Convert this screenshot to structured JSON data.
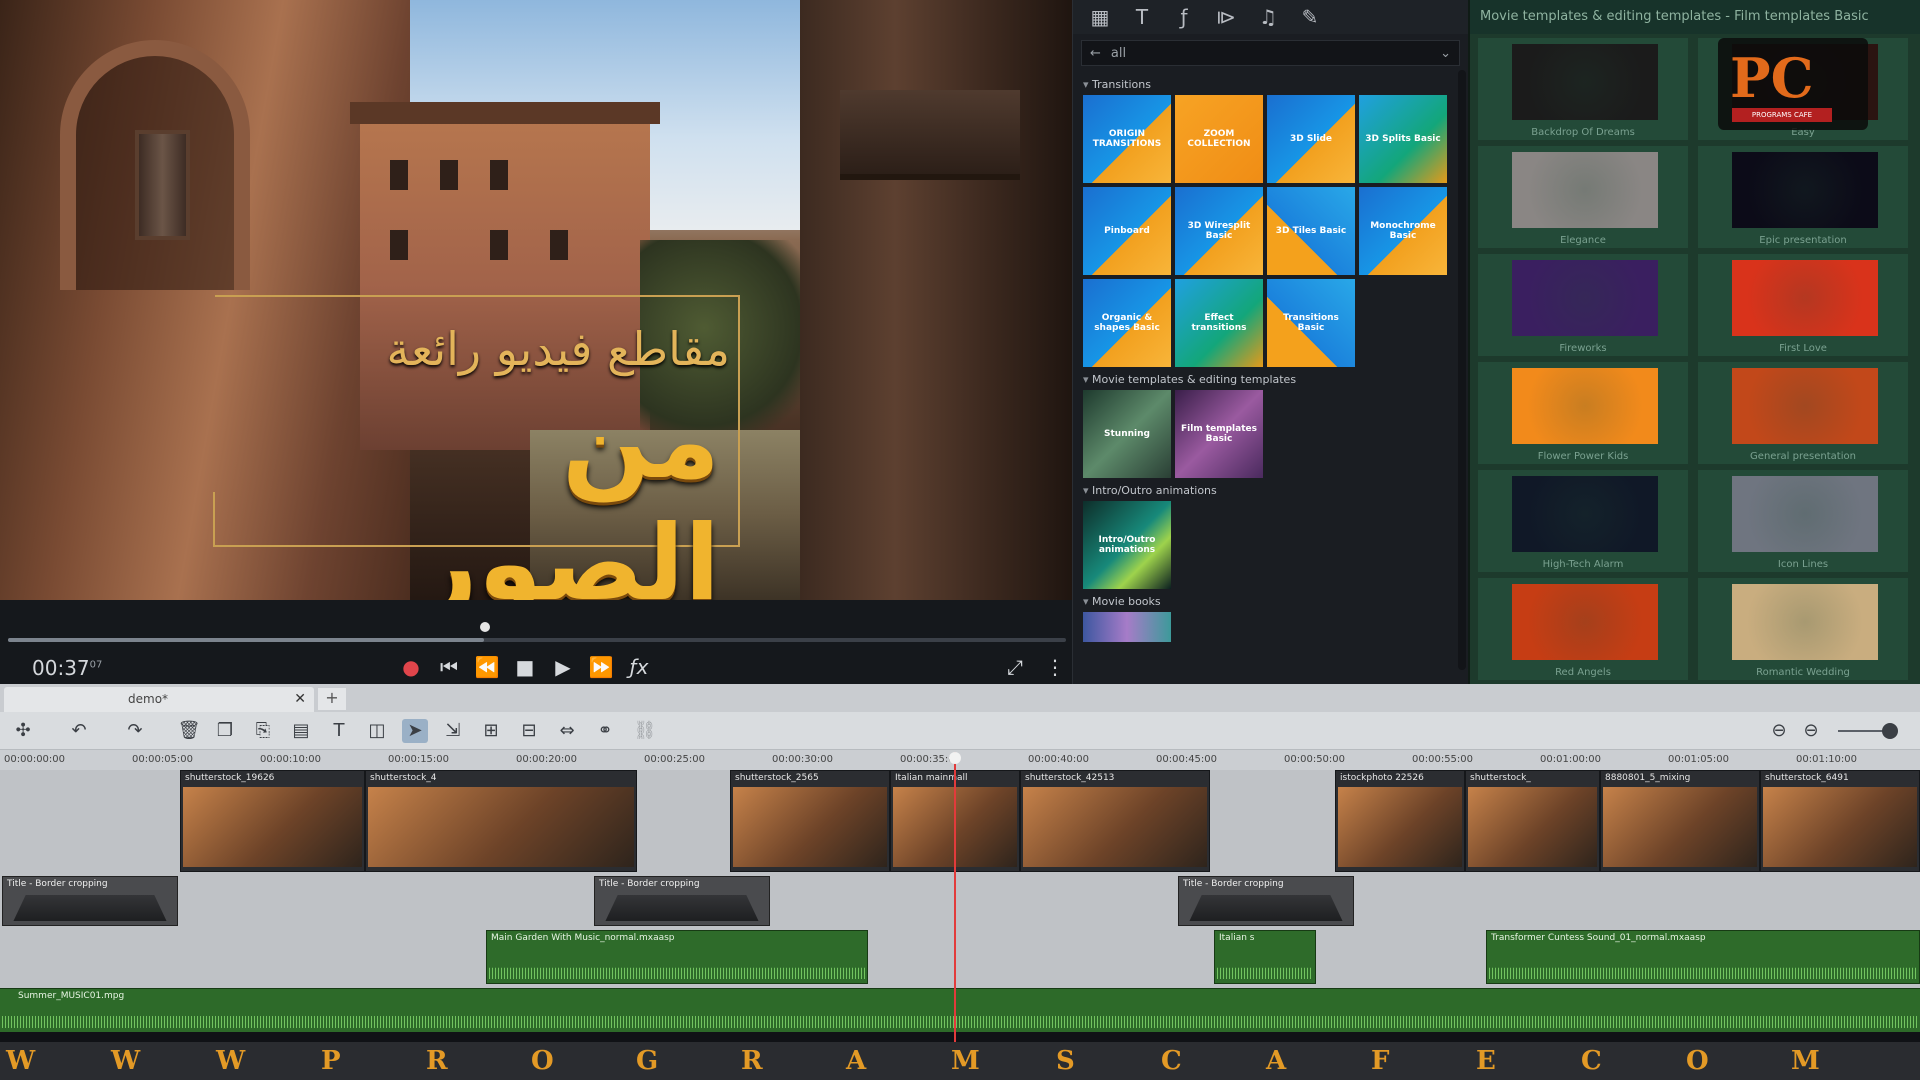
{
  "preview": {
    "title_line1": "مقاطع فيديو رائعة",
    "title_line2": "من الصور",
    "timecode": "00:37",
    "timecode_frames": "07",
    "scrub_fraction": 0.45
  },
  "pool": {
    "filter_label": "all",
    "categories": {
      "transitions": "Transitions",
      "movie": "Movie templates & editing templates",
      "intro": "Intro/Outro animations",
      "moviebooks": "Movie books"
    },
    "transitions": [
      {
        "label": "ORIGIN TRANSITIONS",
        "style": "blue"
      },
      {
        "label": "ZOOM COLLECTION",
        "style": "orange"
      },
      {
        "label": "3D Slide",
        "style": "blue"
      },
      {
        "label": "3D Splits Basic",
        "style": "green"
      },
      {
        "label": "Pinboard",
        "style": "blue"
      },
      {
        "label": "3D Wiresplit Basic",
        "style": "blue"
      },
      {
        "label": "3D Tiles Basic",
        "style": "mix"
      },
      {
        "label": "Monochrome Basic",
        "style": "blue"
      },
      {
        "label": "Organic & shapes Basic",
        "style": "blue"
      },
      {
        "label": "Effect transitions",
        "style": "green"
      },
      {
        "label": "Transitions Basic",
        "style": "mix"
      }
    ],
    "movie_templates": [
      {
        "label": "Stunning",
        "style": "mov1"
      },
      {
        "label": "Film templates Basic",
        "style": "mov2"
      }
    ],
    "intro_templates": [
      {
        "label": "Intro/Outro animations",
        "style": "intro"
      }
    ]
  },
  "templates": {
    "header": "Movie templates & editing templates - Film templates Basic",
    "items": [
      {
        "label": "Backdrop Of Dreams",
        "color": "#1b1b1b"
      },
      {
        "label": "Easy",
        "color": "#2b1411"
      },
      {
        "label": "Elegance",
        "color": "#8a8684"
      },
      {
        "label": "Epic presentation",
        "color": "#0c0b18"
      },
      {
        "label": "Fireworks",
        "color": "#3a1f60"
      },
      {
        "label": "First Love",
        "color": "#d9331b"
      },
      {
        "label": "Flower Power Kids",
        "color": "#f28a1b"
      },
      {
        "label": "General presentation",
        "color": "#c2481a"
      },
      {
        "label": "High-Tech Alarm",
        "color": "#101827"
      },
      {
        "label": "Icon Lines",
        "color": "#6f7580"
      },
      {
        "label": "Red Angels",
        "color": "#c63d14"
      },
      {
        "label": "Romantic Wedding",
        "color": "#c9ad7f"
      }
    ],
    "logo_text": "PC",
    "logo_sub": "PROGRAMS CAFE"
  },
  "timeline": {
    "tab_label": "demo*",
    "ruler": [
      "00:00:00:00",
      "00:00:05:00",
      "00:00:10:00",
      "00:00:15:00",
      "00:00:20:00",
      "00:00:25:00",
      "00:00:30:00",
      "00:00:35:00",
      "00:00:40:00",
      "00:00:45:00",
      "00:00:50:00",
      "00:00:55:00",
      "00:01:00:00",
      "00:01:05:00",
      "00:01:10:00"
    ],
    "video_clips": [
      {
        "label": "shutterstock_19626",
        "start": 180,
        "width": 185
      },
      {
        "label": "shutterstock_4",
        "start": 365,
        "width": 272
      },
      {
        "label": "shutterstock_2565",
        "start": 730,
        "width": 160
      },
      {
        "label": "Italian mainmall",
        "start": 890,
        "width": 130
      },
      {
        "label": "shutterstock_42513",
        "start": 1020,
        "width": 190
      },
      {
        "label": "istockphoto 22526",
        "start": 1335,
        "width": 130
      },
      {
        "label": "shutterstock_",
        "start": 1465,
        "width": 135
      },
      {
        "label": "8880801_5_mixing",
        "start": 1600,
        "width": 160
      },
      {
        "label": "shutterstock_6491",
        "start": 1760,
        "width": 160
      }
    ],
    "title_clips": [
      {
        "label": "Title - Border cropping",
        "start": 2,
        "width": 176
      },
      {
        "label": "Title - Border cropping",
        "start": 594,
        "width": 176
      },
      {
        "label": "Title - Border cropping",
        "start": 1178,
        "width": 176
      }
    ],
    "audio_clips": [
      {
        "label": "Main Garden With Music_normal.mxaasp",
        "start": 486,
        "width": 382
      },
      {
        "label": "Italian s",
        "start": 1214,
        "width": 102
      },
      {
        "label": "Transformer Cuntess Sound_01_normal.mxaasp",
        "start": 1486,
        "width": 434
      }
    ],
    "music_label": "Summer_MUSIC01.mpg"
  },
  "watermark": {
    "letters": [
      "W",
      "W",
      "W",
      "P",
      "R",
      "O",
      "G",
      "R",
      "A",
      "M",
      "S",
      "C",
      "A",
      "F",
      "E",
      "C",
      "O",
      "M"
    ]
  }
}
